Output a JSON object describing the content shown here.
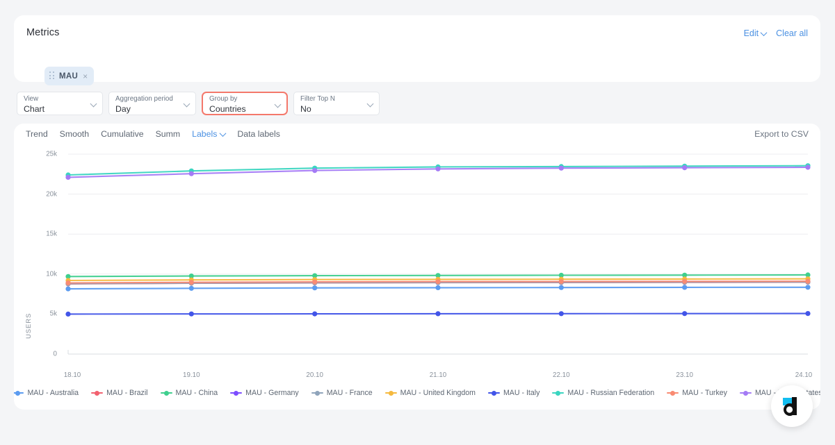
{
  "metrics": {
    "title": "Metrics",
    "edit_label": "Edit",
    "clear_all_label": "Clear all",
    "chip_label": "MAU",
    "chip_close": "×"
  },
  "selectors": [
    {
      "label": "View",
      "value": "Chart",
      "highlighted": false
    },
    {
      "label": "Aggregation period",
      "value": "Day",
      "highlighted": false
    },
    {
      "label": "Group by",
      "value": "Countries",
      "highlighted": true
    },
    {
      "label": "Filter Top N",
      "value": "No",
      "highlighted": false
    }
  ],
  "toolbar": {
    "items": [
      "Trend",
      "Smooth",
      "Cumulative",
      "Summ"
    ],
    "labels_label": "Labels",
    "data_labels_label": "Data labels",
    "export_label": "Export to CSV"
  },
  "colors": {
    "accent_blue": "#4a90e2",
    "highlight_red": "#f4786b",
    "chip_bg": "#e2ecf7",
    "page_bg": "#f4f5f7",
    "card_bg": "#ffffff",
    "grid": "#ededf0",
    "axis_text": "#8a929c"
  },
  "chart_data": {
    "type": "line",
    "title": "",
    "xlabel": "",
    "ylabel": "USERS",
    "x": [
      "18.10",
      "19.10",
      "20.10",
      "21.10",
      "22.10",
      "23.10",
      "24.10"
    ],
    "yticks": [
      0,
      5000,
      10000,
      15000,
      20000,
      25000
    ],
    "yticklabels": [
      "0",
      "5k",
      "10k",
      "15k",
      "20k",
      "25k"
    ],
    "ylim": [
      0,
      25000
    ],
    "grid": true,
    "legend_position": "bottom",
    "series": [
      {
        "name": "MAU - Australia",
        "color": "#5b9bf0",
        "values": [
          8150,
          8220,
          8270,
          8300,
          8320,
          8340,
          8350
        ]
      },
      {
        "name": "MAU - Brazil",
        "color": "#f2616f",
        "values": [
          8780,
          8850,
          8900,
          8930,
          8950,
          8970,
          8990
        ]
      },
      {
        "name": "MAU - China",
        "color": "#3fcf8e",
        "values": [
          9700,
          9760,
          9800,
          9830,
          9850,
          9870,
          9900
        ]
      },
      {
        "name": "MAU - Germany",
        "color": "#7c4dff",
        "values": [
          8860,
          8930,
          8980,
          9010,
          9030,
          9050,
          9070
        ]
      },
      {
        "name": "MAU - France",
        "color": "#8fa4bb",
        "values": [
          8800,
          8870,
          8920,
          8950,
          8970,
          8990,
          9010
        ]
      },
      {
        "name": "MAU - United Kingdom",
        "color": "#f5b93f",
        "values": [
          9200,
          9270,
          9310,
          9340,
          9360,
          9380,
          9400
        ]
      },
      {
        "name": "MAU - Italy",
        "color": "#4255e8",
        "values": [
          5000,
          5020,
          5030,
          5040,
          5050,
          5060,
          5070
        ]
      },
      {
        "name": "MAU - Russian Federation",
        "color": "#3ad5c0",
        "values": [
          22400,
          22900,
          23250,
          23400,
          23450,
          23500,
          23550
        ]
      },
      {
        "name": "MAU - Turkey",
        "color": "#f98b72",
        "values": [
          8900,
          8970,
          9020,
          9050,
          9070,
          9090,
          9110
        ]
      },
      {
        "name": "MAU - United States",
        "color": "#a47bf5",
        "values": [
          22100,
          22550,
          22950,
          23150,
          23250,
          23300,
          23350
        ]
      }
    ]
  }
}
